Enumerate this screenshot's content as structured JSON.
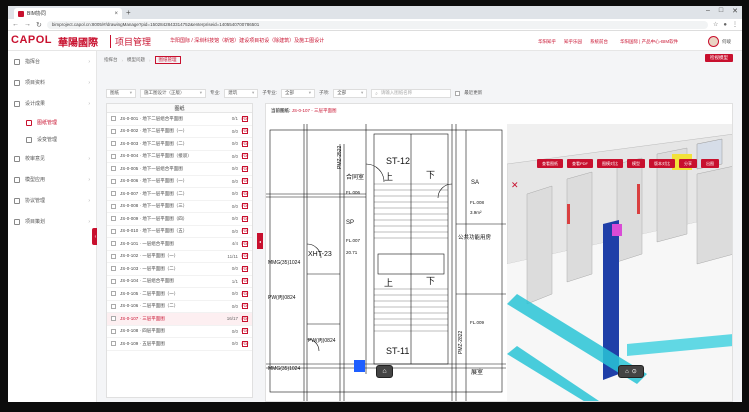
{
  "browser": {
    "tab_title": "BIM协同",
    "url": "bimproject.capol.cn:8005/#/drawingManage?pid=1502842843314752&enterpriseid=1405540700786501"
  },
  "header": {
    "logo_text": "CAPOL",
    "logo_cn": "華陽國際",
    "system_name": "项目管理",
    "project_path": "华阳国际 / 深圳科技馆（新馆）建设项目初设（除建筑）及施工图设计",
    "links": [
      "华阳知乎",
      "知乎乐园",
      "系统前台"
    ],
    "org": "华阳国际 | 产品中心-BIM软件",
    "username": "何峻"
  },
  "sidebar": {
    "items": [
      {
        "label": "指挥台",
        "icon": "dashboard-icon"
      },
      {
        "label": "项目资料",
        "icon": "folder-icon"
      },
      {
        "label": "设计成果",
        "icon": "design-icon"
      },
      {
        "label": "图纸管理",
        "icon": "drawing-icon",
        "sub": true,
        "active": true
      },
      {
        "label": "设变管理",
        "icon": "change-icon",
        "sub": true
      },
      {
        "label": "校审意见",
        "icon": "review-icon"
      },
      {
        "label": "模型应用",
        "icon": "model-icon"
      },
      {
        "label": "协议管理",
        "icon": "contract-icon"
      },
      {
        "label": "项目策划",
        "icon": "plan-icon"
      }
    ],
    "toggle": "‹"
  },
  "main": {
    "breadcrumb": [
      "指挥台",
      "模型问题",
      "图纸管理"
    ],
    "collab_button": "检视模型",
    "filters": {
      "stage": "图纸",
      "category": "施工图设计（正版）",
      "specialty_label": "专业:",
      "specialty": "建筑",
      "subspecialty_label": "子专业:",
      "subspecialty": "全部",
      "floor_label": "子项:",
      "floor": "全部",
      "search_placeholder": "请输入图纸名称",
      "latest_label": "最近更新"
    },
    "list": {
      "header": "图纸",
      "rows": [
        {
          "name": "JS-0-001 · 地下二层组合平面图",
          "pages": "0/1"
        },
        {
          "name": "JS-0-002 · 地下二层平面图（一）",
          "pages": "0/0"
        },
        {
          "name": "JS-0-003 · 地下二层平面图（二）",
          "pages": "0/0"
        },
        {
          "name": "JS-0-004 · 地下二层平面图（接驳）",
          "pages": "0/0"
        },
        {
          "name": "JS-0-005 · 地下一层组合平面图",
          "pages": "0/0"
        },
        {
          "name": "JS-0-006 · 地下一层平面图（一）",
          "pages": "0/0"
        },
        {
          "name": "JS-0-007 · 地下一层平面图（二）",
          "pages": "0/0"
        },
        {
          "name": "JS-0-008 · 地下一层平面图（三）",
          "pages": "0/0"
        },
        {
          "name": "JS-0-009 · 地下一层平面图（四）",
          "pages": "0/0"
        },
        {
          "name": "JS-0-010 · 地下一层平面图（五）",
          "pages": "0/0"
        },
        {
          "name": "JS-0-101 · 一层组合平面图",
          "pages": "4/4"
        },
        {
          "name": "JS-0-102 · 一层平面图（一）",
          "pages": "11/11"
        },
        {
          "name": "JS-0-103 · 一层平面图（二）",
          "pages": "0/0"
        },
        {
          "name": "JS-0-104 · 二层组合平面图",
          "pages": "1/1"
        },
        {
          "name": "JS-0-105 · 二层平面图（一）",
          "pages": "0/0"
        },
        {
          "name": "JS-0-106 · 二层平面图（二）",
          "pages": "0/0"
        },
        {
          "name": "JS-0-107 · 三层平面图",
          "pages": "16/17",
          "active": true
        },
        {
          "name": "JS-0-108 · 四层平面图",
          "pages": "0/0"
        },
        {
          "name": "JS-0-109 · 五层平面图",
          "pages": "0/0"
        }
      ],
      "pdf_icon": "PDF"
    },
    "viewer": {
      "title_label": "当前图纸:",
      "title": "JS-0-107 - 三层平面图",
      "buttons": [
        "查看图纸",
        "查看PDF",
        "图模对比",
        "模型",
        "版本对比",
        "分享",
        "出图"
      ],
      "close": "✕",
      "cad": {
        "rooms": [
          "ST-12",
          "ST-11",
          "上",
          "下",
          "上",
          "下",
          "合同室",
          "SP",
          "公共功能用房",
          "展室",
          "SA"
        ],
        "labels": [
          "XHT-23",
          "MMG(35)1024",
          "PW(丙)0824",
          "PMZ-2522",
          "PMZ-2822",
          "PW(丙)0824",
          "FL.006",
          "FL.007",
          "FL.008",
          "FL.009",
          "MMG(35)1024",
          "20.71",
          "3.9m²"
        ],
        "home": "⌂"
      },
      "model": {
        "home": "⌂",
        "extra": "⊙"
      }
    }
  }
}
